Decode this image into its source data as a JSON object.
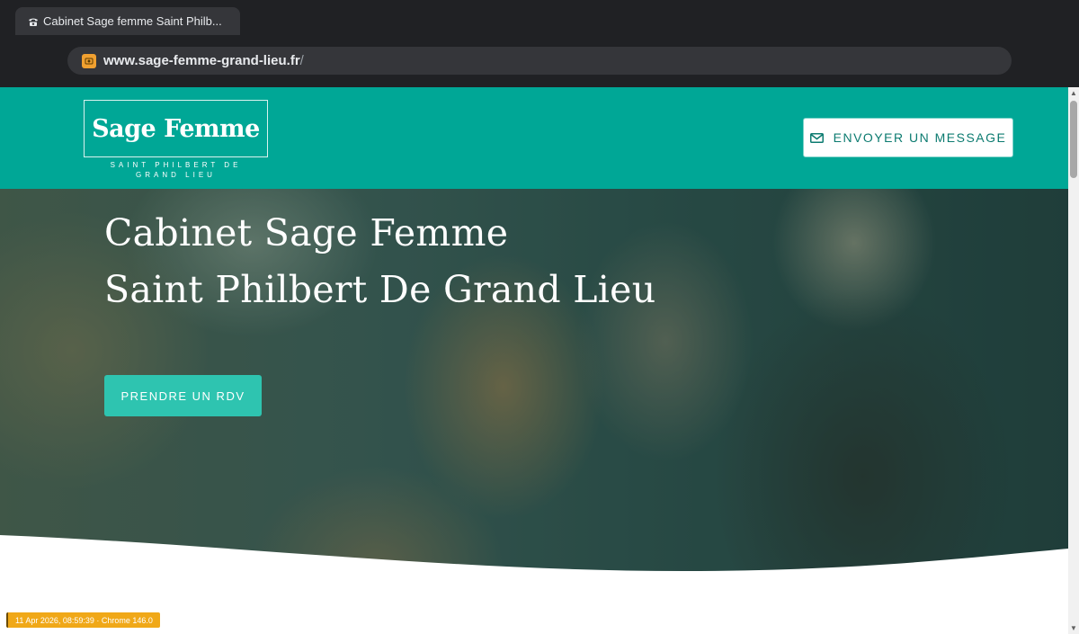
{
  "browser": {
    "tab_title": "Cabinet Sage femme Saint Philb...",
    "tab_icon": "telephone-icon",
    "url_host": "www.sage-femme-grand-lieu.fr",
    "url_path": "/"
  },
  "header": {
    "logo_title": "Sage Femme",
    "logo_subtitle_line1": "SAINT PHILBERT DE",
    "logo_subtitle_line2": "GRAND LIEU",
    "message_button_label": "ENVOYER UN MESSAGE",
    "message_button_icon": "envelope-icon"
  },
  "hero": {
    "title_line1": "Cabinet Sage Femme",
    "title_line2": "Saint Philbert De Grand Lieu",
    "cta_label": "PRENDRE UN RDV"
  },
  "footer_badge": {
    "text": "11 Apr 2026, 08:59:39 · Chrome 146.0"
  },
  "colors": {
    "brand_teal": "#00a796",
    "cta_teal": "#2ec4b0",
    "chrome_dark": "#202124"
  }
}
